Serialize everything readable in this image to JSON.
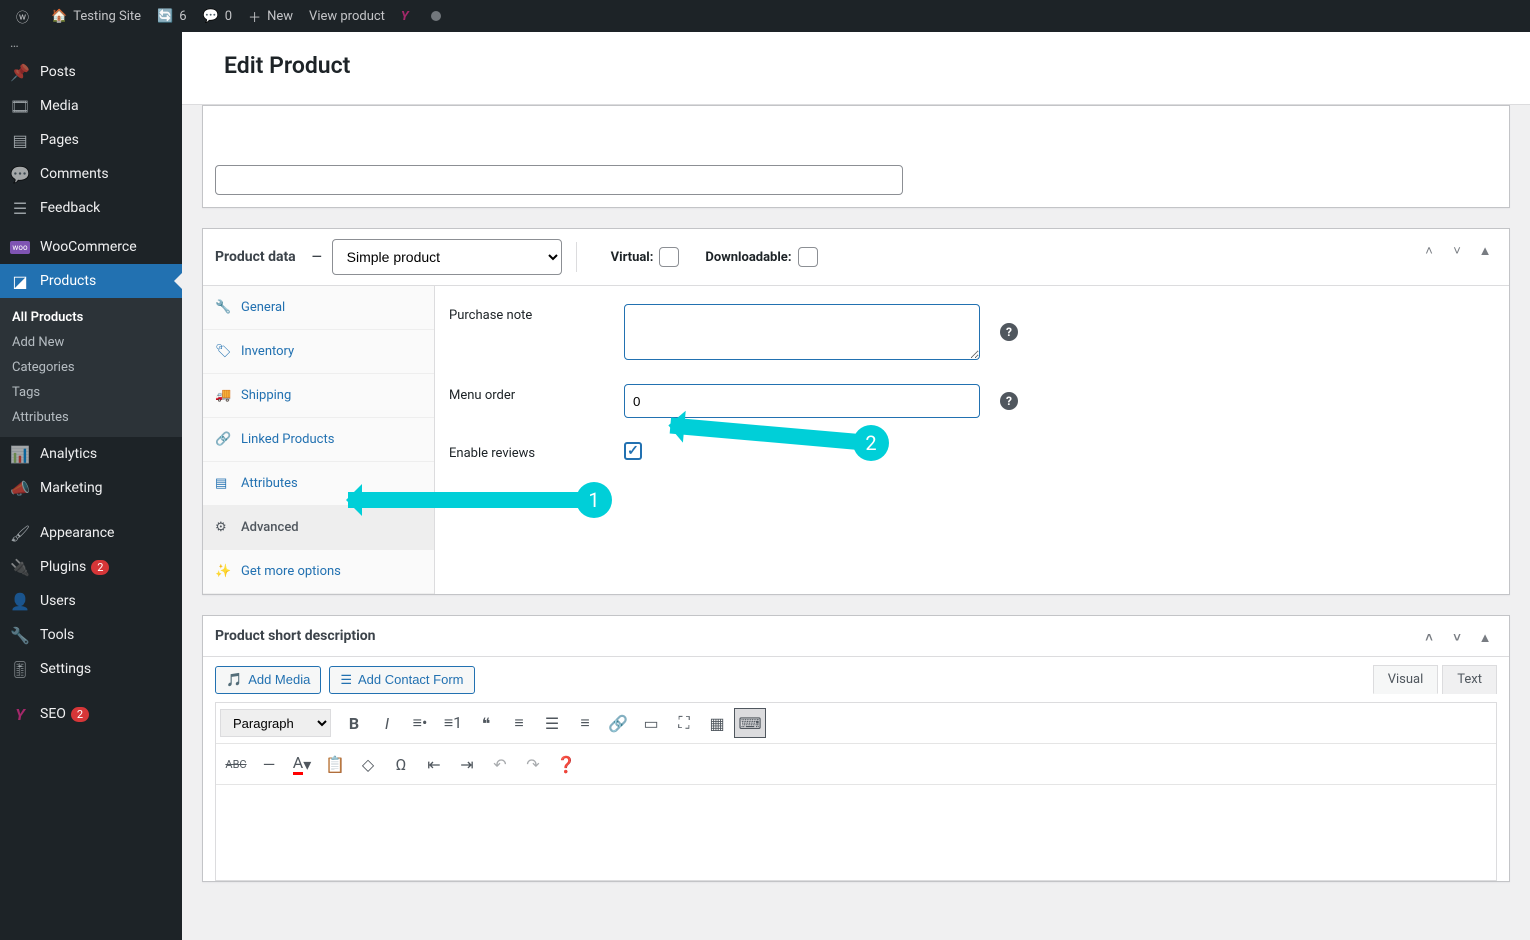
{
  "adminbar": {
    "site_title": "Testing Site",
    "updates_count": "6",
    "comments_count": "0",
    "new_label": "New",
    "view_product": "View product"
  },
  "sidebar": {
    "items": [
      {
        "icon": "📌",
        "label": "Posts"
      },
      {
        "icon": "🖼",
        "label": "Media"
      },
      {
        "icon": "📄",
        "label": "Pages"
      },
      {
        "icon": "💬",
        "label": "Comments"
      },
      {
        "icon": "☰",
        "label": "Feedback"
      }
    ],
    "woo_label": "WooCommerce",
    "products_label": "Products",
    "products_sub": [
      "All Products",
      "Add New",
      "Categories",
      "Tags",
      "Attributes"
    ],
    "items2": [
      {
        "icon": "📊",
        "label": "Analytics"
      },
      {
        "icon": "📣",
        "label": "Marketing"
      }
    ],
    "items3": [
      {
        "icon": "🎨",
        "label": "Appearance"
      },
      {
        "icon": "🔌",
        "label": "Plugins",
        "badge": "2"
      },
      {
        "icon": "👤",
        "label": "Users"
      },
      {
        "icon": "🔧",
        "label": "Tools"
      },
      {
        "icon": "⚙",
        "label": "Settings"
      }
    ],
    "seo_label": "SEO",
    "seo_badge": "2"
  },
  "page": {
    "heading": "Edit Product"
  },
  "product_data": {
    "title": "Product data",
    "dash": "—",
    "type_selected": "Simple product",
    "virtual_label": "Virtual:",
    "downloadable_label": "Downloadable:",
    "tabs": [
      {
        "icon": "🔧",
        "label": "General"
      },
      {
        "icon": "🏷",
        "label": "Inventory"
      },
      {
        "icon": "🚚",
        "label": "Shipping"
      },
      {
        "icon": "🔗",
        "label": "Linked Products"
      },
      {
        "icon": "📋",
        "label": "Attributes"
      },
      {
        "icon": "⚙",
        "label": "Advanced"
      },
      {
        "icon": "✨",
        "label": "Get more options"
      }
    ],
    "fields": {
      "purchase_note_label": "Purchase note",
      "purchase_note_value": "",
      "menu_order_label": "Menu order",
      "menu_order_value": "0",
      "enable_reviews_label": "Enable reviews",
      "enable_reviews_checked": true
    }
  },
  "short_desc": {
    "title": "Product short description",
    "add_media": "Add Media",
    "add_contact": "Add Contact Form",
    "tab_visual": "Visual",
    "tab_text": "Text",
    "format_selected": "Paragraph"
  },
  "annotations": {
    "n1": "1",
    "n2": "2"
  }
}
